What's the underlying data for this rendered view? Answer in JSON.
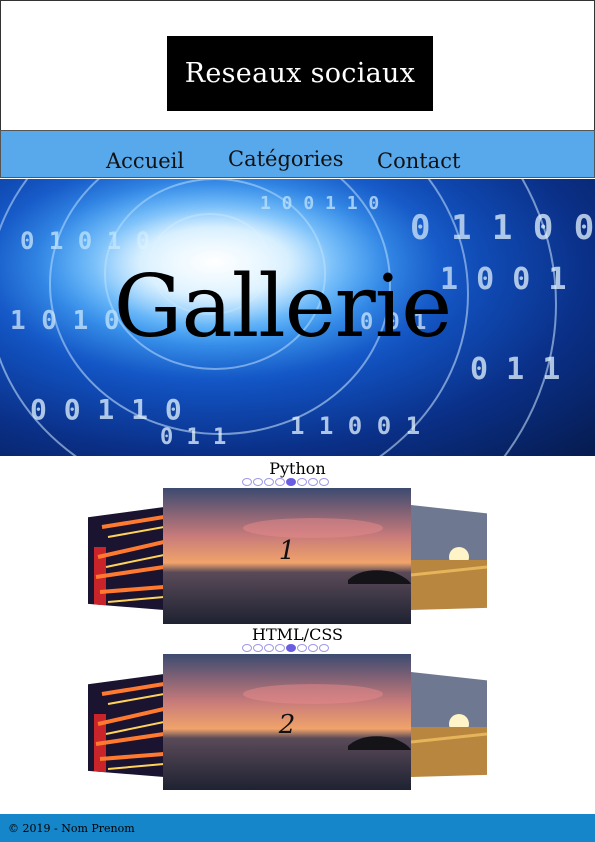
{
  "site": {
    "logo_text": "Reseaux sociaux"
  },
  "nav": {
    "items": [
      {
        "label": "Accueil"
      },
      {
        "label": "Catégories"
      },
      {
        "label": "Contact"
      }
    ]
  },
  "hero": {
    "title": "Gallerie"
  },
  "galleries": [
    {
      "label": "Python",
      "slide_number": "1",
      "dot_count": 8,
      "active_dot": 4
    },
    {
      "label": "HTML/CSS",
      "slide_number": "2",
      "dot_count": 8,
      "active_dot": 4
    }
  ],
  "footer": {
    "text": "© 2019 - Nom Prenom"
  },
  "colors": {
    "nav_bar": "#58a9ec",
    "footer_bar": "#1586c9",
    "logo_bg": "#000000",
    "dot_active": "#6a5de0"
  }
}
